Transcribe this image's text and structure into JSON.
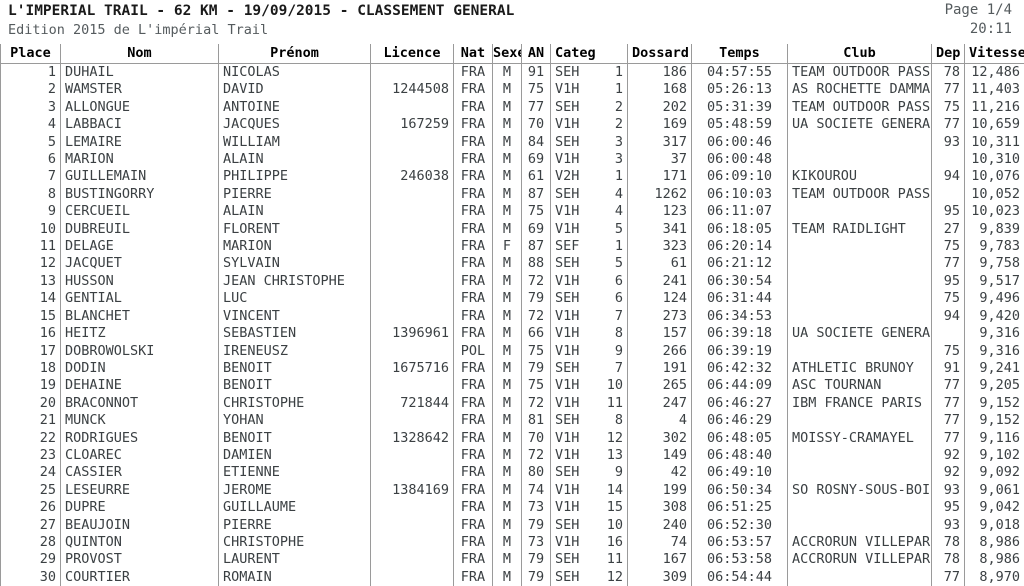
{
  "header": {
    "title": "L'IMPERIAL TRAIL - 62 KM - 19/09/2015 - CLASSEMENT GENERAL",
    "subtitle": "Edition 2015 de L'impérial Trail",
    "page_number": "Page 1/4",
    "time": "20:11"
  },
  "table": {
    "columns": [
      {
        "key": "place",
        "label": "Place"
      },
      {
        "key": "nom",
        "label": "Nom"
      },
      {
        "key": "prenom",
        "label": "Prénom"
      },
      {
        "key": "licence",
        "label": "Licence"
      },
      {
        "key": "nat",
        "label": "Nat"
      },
      {
        "key": "sexe",
        "label": "Sexe"
      },
      {
        "key": "an",
        "label": "AN"
      },
      {
        "key": "categ",
        "label": "Categ."
      },
      {
        "key": "dossard",
        "label": "Dossard"
      },
      {
        "key": "temps",
        "label": "Temps"
      },
      {
        "key": "club",
        "label": "Club"
      },
      {
        "key": "dep",
        "label": "Dep"
      },
      {
        "key": "vitesse",
        "label": "Vitesse"
      }
    ],
    "rows": [
      {
        "place": "1",
        "nom": "DUHAIL",
        "prenom": "NICOLAS",
        "licence": "",
        "nat": "FRA",
        "sexe": "M",
        "an": "91",
        "categ": "SEH",
        "rang": "1",
        "dossard": "186",
        "temps": "04:57:55",
        "club": "TEAM OUTDOOR PASSION",
        "dep": "78",
        "vitesse": "12,486"
      },
      {
        "place": "2",
        "nom": "WAMSTER",
        "prenom": "DAVID",
        "licence": "1244508",
        "nat": "FRA",
        "sexe": "M",
        "an": "75",
        "categ": "V1H",
        "rang": "1",
        "dossard": "168",
        "temps": "05:26:13",
        "club": "AS ROCHETTE DAMMARIE",
        "dep": "77",
        "vitesse": "11,403"
      },
      {
        "place": "3",
        "nom": "ALLONGUE",
        "prenom": "ANTOINE",
        "licence": "",
        "nat": "FRA",
        "sexe": "M",
        "an": "77",
        "categ": "SEH",
        "rang": "2",
        "dossard": "202",
        "temps": "05:31:39",
        "club": "TEAM OUTDOOR PASSION",
        "dep": "75",
        "vitesse": "11,216"
      },
      {
        "place": "4",
        "nom": "LABBACI",
        "prenom": "JACQUES",
        "licence": "167259",
        "nat": "FRA",
        "sexe": "M",
        "an": "70",
        "categ": "V1H",
        "rang": "2",
        "dossard": "169",
        "temps": "05:48:59",
        "club": "UA SOCIETE GENERALE",
        "dep": "77",
        "vitesse": "10,659"
      },
      {
        "place": "5",
        "nom": "LEMAIRE",
        "prenom": "WILLIAM",
        "licence": "",
        "nat": "FRA",
        "sexe": "M",
        "an": "84",
        "categ": "SEH",
        "rang": "3",
        "dossard": "317",
        "temps": "06:00:46",
        "club": "",
        "dep": "93",
        "vitesse": "10,311"
      },
      {
        "place": "6",
        "nom": "MARION",
        "prenom": "ALAIN",
        "licence": "",
        "nat": "FRA",
        "sexe": "M",
        "an": "69",
        "categ": "V1H",
        "rang": "3",
        "dossard": "37",
        "temps": "06:00:48",
        "club": "",
        "dep": "",
        "vitesse": "10,310"
      },
      {
        "place": "7",
        "nom": "GUILLEMAIN",
        "prenom": "PHILIPPE",
        "licence": "246038",
        "nat": "FRA",
        "sexe": "M",
        "an": "61",
        "categ": "V2H",
        "rang": "1",
        "dossard": "171",
        "temps": "06:09:10",
        "club": "KIKOUROU",
        "dep": "94",
        "vitesse": "10,076"
      },
      {
        "place": "8",
        "nom": "BUSTINGORRY",
        "prenom": "PIERRE",
        "licence": "",
        "nat": "FRA",
        "sexe": "M",
        "an": "87",
        "categ": "SEH",
        "rang": "4",
        "dossard": "1262",
        "temps": "06:10:03",
        "club": "TEAM OUTDOOR PASSION",
        "dep": "",
        "vitesse": "10,052"
      },
      {
        "place": "9",
        "nom": "CERCUEIL",
        "prenom": "ALAIN",
        "licence": "",
        "nat": "FRA",
        "sexe": "M",
        "an": "75",
        "categ": "V1H",
        "rang": "4",
        "dossard": "123",
        "temps": "06:11:07",
        "club": "",
        "dep": "95",
        "vitesse": "10,023"
      },
      {
        "place": "10",
        "nom": "DUBREUIL",
        "prenom": "FLORENT",
        "licence": "",
        "nat": "FRA",
        "sexe": "M",
        "an": "69",
        "categ": "V1H",
        "rang": "5",
        "dossard": "341",
        "temps": "06:18:05",
        "club": "TEAM RAIDLIGHT",
        "dep": "27",
        "vitesse": "9,839"
      },
      {
        "place": "11",
        "nom": "DELAGE",
        "prenom": "MARION",
        "licence": "",
        "nat": "FRA",
        "sexe": "F",
        "an": "87",
        "categ": "SEF",
        "rang": "1",
        "dossard": "323",
        "temps": "06:20:14",
        "club": "",
        "dep": "75",
        "vitesse": "9,783"
      },
      {
        "place": "12",
        "nom": "JACQUET",
        "prenom": "SYLVAIN",
        "licence": "",
        "nat": "FRA",
        "sexe": "M",
        "an": "88",
        "categ": "SEH",
        "rang": "5",
        "dossard": "61",
        "temps": "06:21:12",
        "club": "",
        "dep": "77",
        "vitesse": "9,758"
      },
      {
        "place": "13",
        "nom": "HUSSON",
        "prenom": "JEAN CHRISTOPHE",
        "licence": "",
        "nat": "FRA",
        "sexe": "M",
        "an": "72",
        "categ": "V1H",
        "rang": "6",
        "dossard": "241",
        "temps": "06:30:54",
        "club": "",
        "dep": "95",
        "vitesse": "9,517"
      },
      {
        "place": "14",
        "nom": "GENTIAL",
        "prenom": "LUC",
        "licence": "",
        "nat": "FRA",
        "sexe": "M",
        "an": "79",
        "categ": "SEH",
        "rang": "6",
        "dossard": "124",
        "temps": "06:31:44",
        "club": "",
        "dep": "75",
        "vitesse": "9,496"
      },
      {
        "place": "15",
        "nom": "BLANCHET",
        "prenom": "VINCENT",
        "licence": "",
        "nat": "FRA",
        "sexe": "M",
        "an": "72",
        "categ": "V1H",
        "rang": "7",
        "dossard": "273",
        "temps": "06:34:53",
        "club": "",
        "dep": "94",
        "vitesse": "9,420"
      },
      {
        "place": "16",
        "nom": "HEITZ",
        "prenom": "SEBASTIEN",
        "licence": "1396961",
        "nat": "FRA",
        "sexe": "M",
        "an": "66",
        "categ": "V1H",
        "rang": "8",
        "dossard": "157",
        "temps": "06:39:18",
        "club": "UA SOCIETE GENERALE",
        "dep": "",
        "vitesse": "9,316"
      },
      {
        "place": "17",
        "nom": "DOBROWOLSKI",
        "prenom": "IRENEUSZ",
        "licence": "",
        "nat": "POL",
        "sexe": "M",
        "an": "75",
        "categ": "V1H",
        "rang": "9",
        "dossard": "266",
        "temps": "06:39:19",
        "club": "",
        "dep": "75",
        "vitesse": "9,316"
      },
      {
        "place": "18",
        "nom": "DODIN",
        "prenom": "BENOIT",
        "licence": "1675716",
        "nat": "FRA",
        "sexe": "M",
        "an": "79",
        "categ": "SEH",
        "rang": "7",
        "dossard": "191",
        "temps": "06:42:32",
        "club": "ATHLETIC BRUNOY",
        "dep": "91",
        "vitesse": "9,241"
      },
      {
        "place": "19",
        "nom": "DEHAINE",
        "prenom": "BENOIT",
        "licence": "",
        "nat": "FRA",
        "sexe": "M",
        "an": "75",
        "categ": "V1H",
        "rang": "10",
        "dossard": "265",
        "temps": "06:44:09",
        "club": "ASC TOURNAN",
        "dep": "77",
        "vitesse": "9,205"
      },
      {
        "place": "20",
        "nom": "BRACONNOT",
        "prenom": "CHRISTOPHE",
        "licence": "721844",
        "nat": "FRA",
        "sexe": "M",
        "an": "72",
        "categ": "V1H",
        "rang": "11",
        "dossard": "247",
        "temps": "06:46:27",
        "club": "IBM FRANCE PARIS",
        "dep": "77",
        "vitesse": "9,152"
      },
      {
        "place": "21",
        "nom": "MUNCK",
        "prenom": "YOHAN",
        "licence": "",
        "nat": "FRA",
        "sexe": "M",
        "an": "81",
        "categ": "SEH",
        "rang": "8",
        "dossard": "4",
        "temps": "06:46:29",
        "club": "",
        "dep": "77",
        "vitesse": "9,152"
      },
      {
        "place": "22",
        "nom": "RODRIGUES",
        "prenom": "BENOIT",
        "licence": "1328642",
        "nat": "FRA",
        "sexe": "M",
        "an": "70",
        "categ": "V1H",
        "rang": "12",
        "dossard": "302",
        "temps": "06:48:05",
        "club": "MOISSY-CRAMAYEL",
        "dep": "77",
        "vitesse": "9,116"
      },
      {
        "place": "23",
        "nom": "CLOAREC",
        "prenom": "DAMIEN",
        "licence": "",
        "nat": "FRA",
        "sexe": "M",
        "an": "72",
        "categ": "V1H",
        "rang": "13",
        "dossard": "149",
        "temps": "06:48:40",
        "club": "",
        "dep": "92",
        "vitesse": "9,102"
      },
      {
        "place": "24",
        "nom": "CASSIER",
        "prenom": "ETIENNE",
        "licence": "",
        "nat": "FRA",
        "sexe": "M",
        "an": "80",
        "categ": "SEH",
        "rang": "9",
        "dossard": "42",
        "temps": "06:49:10",
        "club": "",
        "dep": "92",
        "vitesse": "9,092"
      },
      {
        "place": "25",
        "nom": "LESEURRE",
        "prenom": "JEROME",
        "licence": "1384169",
        "nat": "FRA",
        "sexe": "M",
        "an": "74",
        "categ": "V1H",
        "rang": "14",
        "dossard": "199",
        "temps": "06:50:34",
        "club": "SO ROSNY-SOUS-BOIS",
        "dep": "93",
        "vitesse": "9,061"
      },
      {
        "place": "26",
        "nom": "DUPRE",
        "prenom": "GUILLAUME",
        "licence": "",
        "nat": "FRA",
        "sexe": "M",
        "an": "73",
        "categ": "V1H",
        "rang": "15",
        "dossard": "308",
        "temps": "06:51:25",
        "club": "",
        "dep": "95",
        "vitesse": "9,042"
      },
      {
        "place": "27",
        "nom": "BEAUJOIN",
        "prenom": "PIERRE",
        "licence": "",
        "nat": "FRA",
        "sexe": "M",
        "an": "79",
        "categ": "SEH",
        "rang": "10",
        "dossard": "240",
        "temps": "06:52:30",
        "club": "",
        "dep": "93",
        "vitesse": "9,018"
      },
      {
        "place": "28",
        "nom": "QUINTON",
        "prenom": "CHRISTOPHE",
        "licence": "",
        "nat": "FRA",
        "sexe": "M",
        "an": "73",
        "categ": "V1H",
        "rang": "16",
        "dossard": "74",
        "temps": "06:53:57",
        "club": "ACCRORUN VILLEPARISIS",
        "dep": "78",
        "vitesse": "8,986"
      },
      {
        "place": "29",
        "nom": "PROVOST",
        "prenom": "LAURENT",
        "licence": "",
        "nat": "FRA",
        "sexe": "M",
        "an": "79",
        "categ": "SEH",
        "rang": "11",
        "dossard": "167",
        "temps": "06:53:58",
        "club": "ACCRORUN VILLEPARISIS",
        "dep": "78",
        "vitesse": "8,986"
      },
      {
        "place": "30",
        "nom": "COURTIER",
        "prenom": "ROMAIN",
        "licence": "",
        "nat": "FRA",
        "sexe": "M",
        "an": "79",
        "categ": "SEH",
        "rang": "12",
        "dossard": "309",
        "temps": "06:54:44",
        "club": "",
        "dep": "77",
        "vitesse": "8,970"
      }
    ]
  }
}
